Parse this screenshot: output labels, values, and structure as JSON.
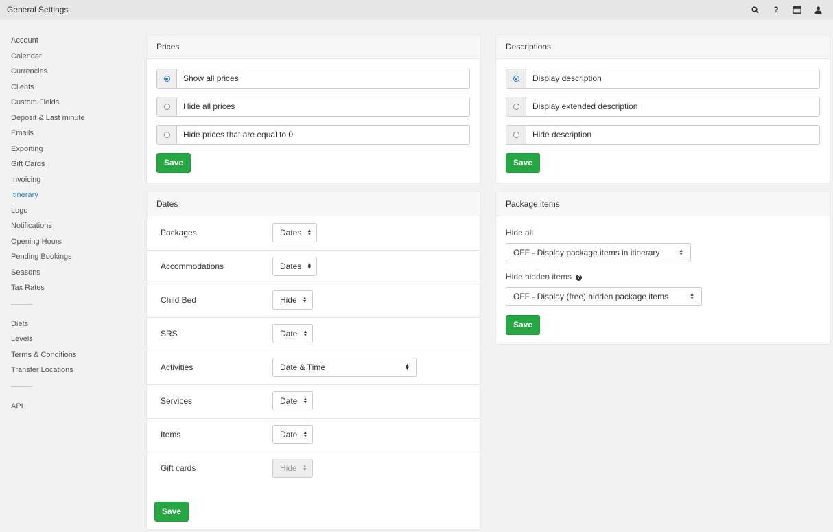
{
  "topbar": {
    "title": "General Settings",
    "icons": [
      "search-icon",
      "help-icon",
      "display-icon",
      "user-icon"
    ]
  },
  "sidebar": {
    "group1": [
      "Account",
      "Calendar",
      "Currencies",
      "Clients",
      "Custom Fields",
      "Deposit & Last minute",
      "Emails",
      "Exporting",
      "Gift Cards",
      "Invoicing",
      "Itinerary",
      "Logo",
      "Notifications",
      "Opening Hours",
      "Pending Bookings",
      "Seasons",
      "Tax Rates"
    ],
    "group2": [
      "Diets",
      "Levels",
      "Terms & Conditions",
      "Transfer Locations"
    ],
    "group3": [
      "API"
    ],
    "active": "Itinerary"
  },
  "prices": {
    "title": "Prices",
    "options": [
      "Show all prices",
      "Hide all prices",
      "Hide prices that are equal to 0"
    ],
    "selected_index": 0,
    "save_label": "Save"
  },
  "descriptions": {
    "title": "Descriptions",
    "options": [
      "Display description",
      "Display extended description",
      "Hide description"
    ],
    "selected_index": 0,
    "save_label": "Save"
  },
  "dates": {
    "title": "Dates",
    "rows": [
      {
        "label": "Packages",
        "value": "Dates"
      },
      {
        "label": "Accommodations",
        "value": "Dates"
      },
      {
        "label": "Child Bed",
        "value": "Hide"
      },
      {
        "label": "SRS",
        "value": "Date"
      },
      {
        "label": "Activities",
        "value": "Date & Time"
      },
      {
        "label": "Services",
        "value": "Date"
      },
      {
        "label": "Items",
        "value": "Date"
      },
      {
        "label": "Gift cards",
        "value": "Hide",
        "disabled": true
      }
    ],
    "save_label": "Save"
  },
  "package_items": {
    "title": "Package items",
    "hide_all_label": "Hide all",
    "hide_all_value": "OFF - Display package items in itinerary",
    "hide_hidden_label": "Hide hidden items",
    "hide_hidden_value": "OFF - Display (free) hidden package items",
    "save_label": "Save"
  },
  "colors": {
    "accent": "#2a85c7",
    "save_button": "#27a744",
    "radio_selected": "#2a7ae2"
  }
}
